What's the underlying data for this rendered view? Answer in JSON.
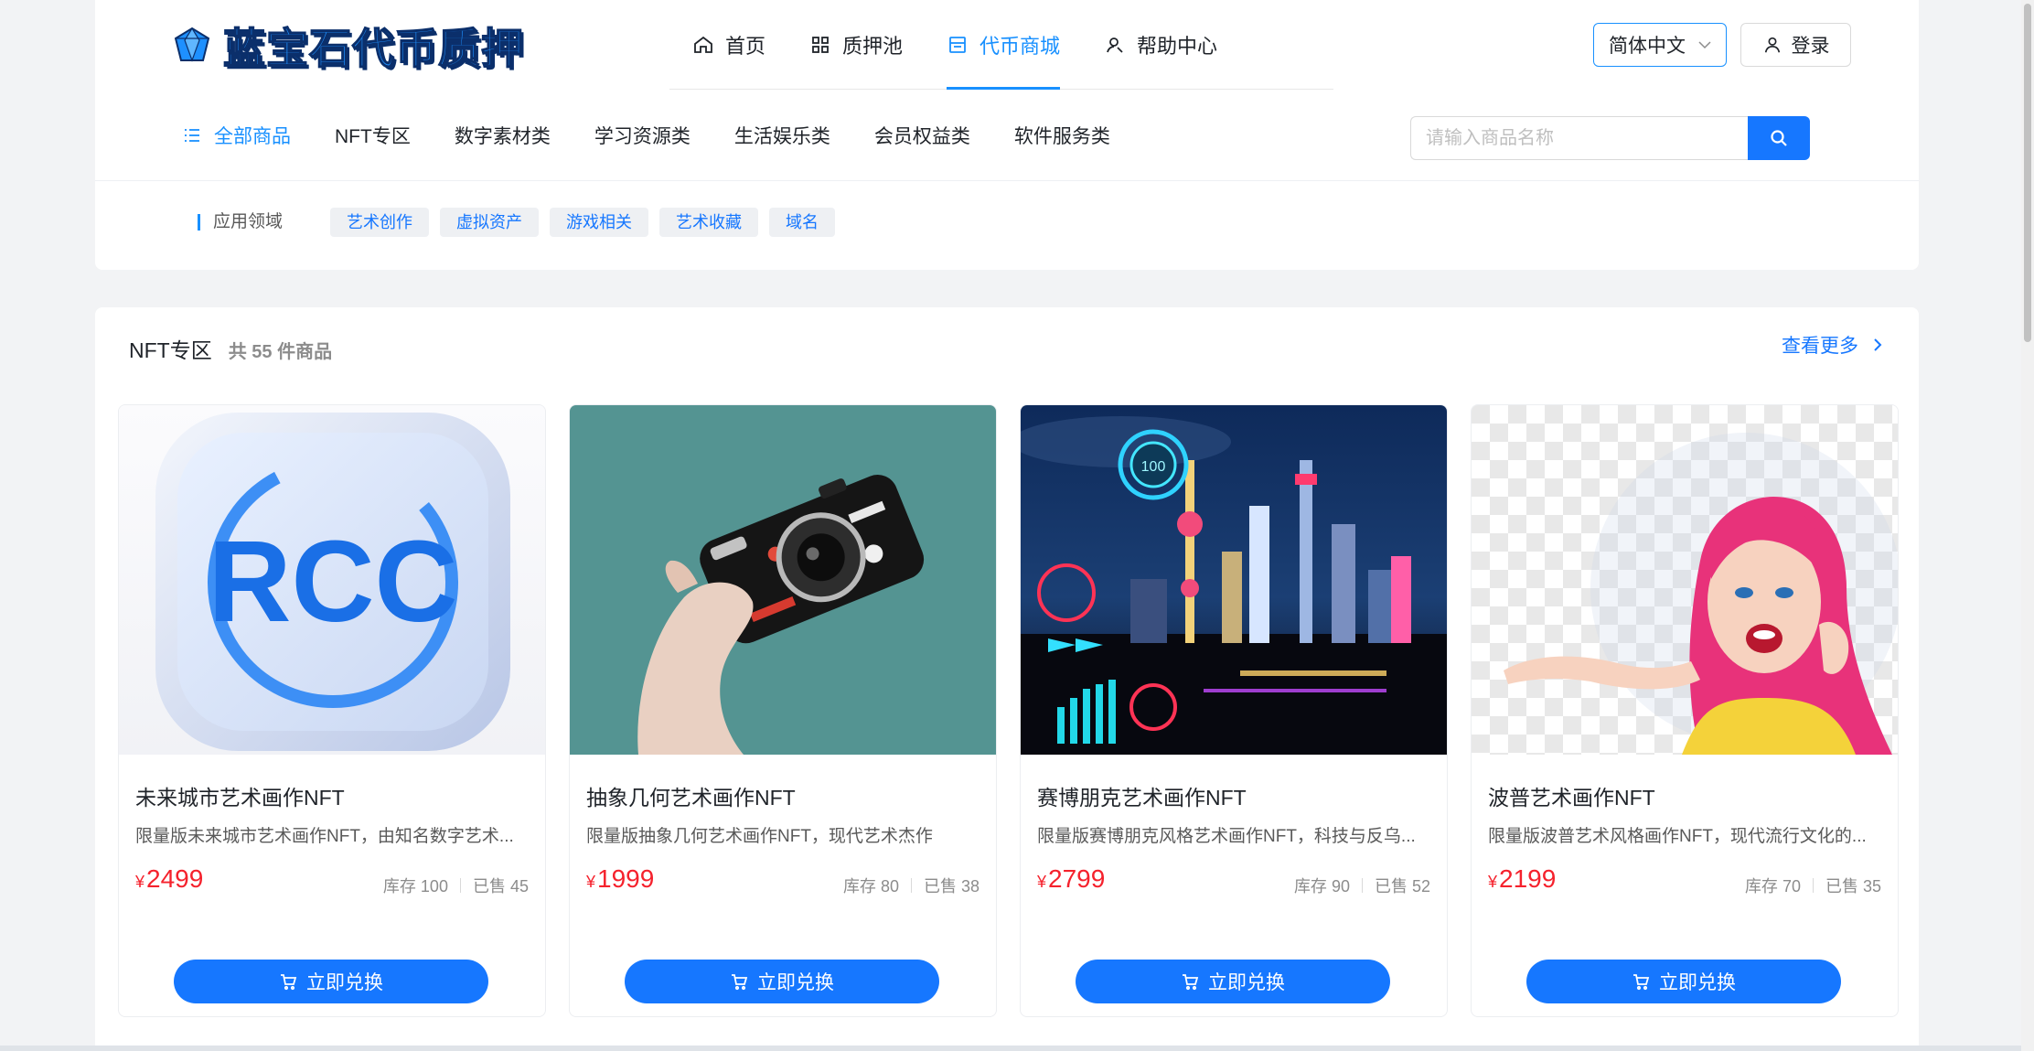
{
  "brand": {
    "name": "蓝宝石代币质押"
  },
  "nav": {
    "items": [
      {
        "label": "首页",
        "icon": "home-icon"
      },
      {
        "label": "质押池",
        "icon": "grid-icon"
      },
      {
        "label": "代币商城",
        "icon": "store-icon",
        "active": true
      },
      {
        "label": "帮助中心",
        "icon": "help-icon"
      }
    ]
  },
  "header": {
    "language": "简体中文",
    "login": "登录"
  },
  "categories": {
    "items": [
      "全部商品",
      "NFT专区",
      "数字素材类",
      "学习资源类",
      "生活娱乐类",
      "会员权益类",
      "软件服务类"
    ],
    "active": "全部商品"
  },
  "search": {
    "placeholder": "请输入商品名称",
    "value": ""
  },
  "filter": {
    "label": "应用领域",
    "tags": [
      "艺术创作",
      "虚拟资产",
      "游戏相关",
      "艺术收藏",
      "域名"
    ]
  },
  "section": {
    "title": "NFT专区",
    "count": "共 55 件商品",
    "more": "查看更多"
  },
  "products": [
    {
      "title": "未来城市艺术画作NFT",
      "desc": "限量版未来城市艺术画作NFT，由知名数字艺术...",
      "currency": "¥",
      "price": "2499",
      "stock": "库存 100",
      "sold": "已售 45",
      "button": "立即兑换"
    },
    {
      "title": "抽象几何艺术画作NFT",
      "desc": "限量版抽象几何艺术画作NFT，现代艺术杰作",
      "currency": "¥",
      "price": "1999",
      "stock": "库存 80",
      "sold": "已售 38",
      "button": "立即兑换"
    },
    {
      "title": "赛博朋克艺术画作NFT",
      "desc": "限量版赛博朋克风格艺术画作NFT，科技与反乌...",
      "currency": "¥",
      "price": "2799",
      "stock": "库存 90",
      "sold": "已售 52",
      "button": "立即兑换"
    },
    {
      "title": "波普艺术画作NFT",
      "desc": "限量版波普艺术风格画作NFT，现代流行文化的...",
      "currency": "¥",
      "price": "2199",
      "stock": "库存 70",
      "sold": "已售 35",
      "button": "立即兑换"
    }
  ],
  "images": {
    "rcc_text": "RCC",
    "badge_100": "100"
  },
  "colors": {
    "accent": "#1677ff",
    "price": "#f5222d"
  }
}
